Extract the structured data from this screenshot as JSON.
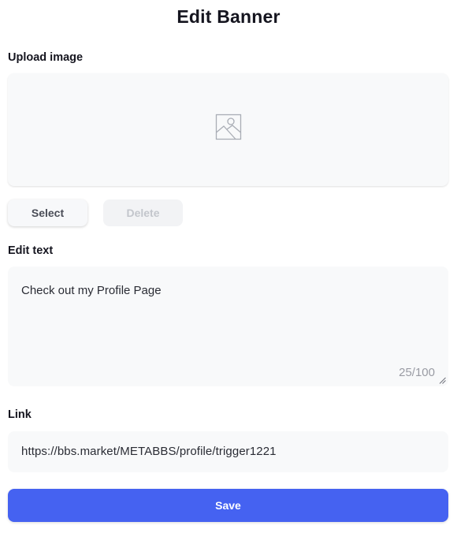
{
  "dialog": {
    "title": "Edit Banner"
  },
  "upload": {
    "label": "Upload image",
    "icon": "image-placeholder-icon",
    "select_label": "Select",
    "delete_label": "Delete"
  },
  "text_section": {
    "label": "Edit text",
    "value": "Check out my Profile Page",
    "char_count": "25/100"
  },
  "link_section": {
    "label": "Link",
    "value": "https://bbs.market/METABBS/profile/trigger1221"
  },
  "actions": {
    "save_label": "Save"
  },
  "colors": {
    "accent": "#4562f1",
    "field_background": "#f8f9fa",
    "disabled_text": "#c3c6cc"
  }
}
